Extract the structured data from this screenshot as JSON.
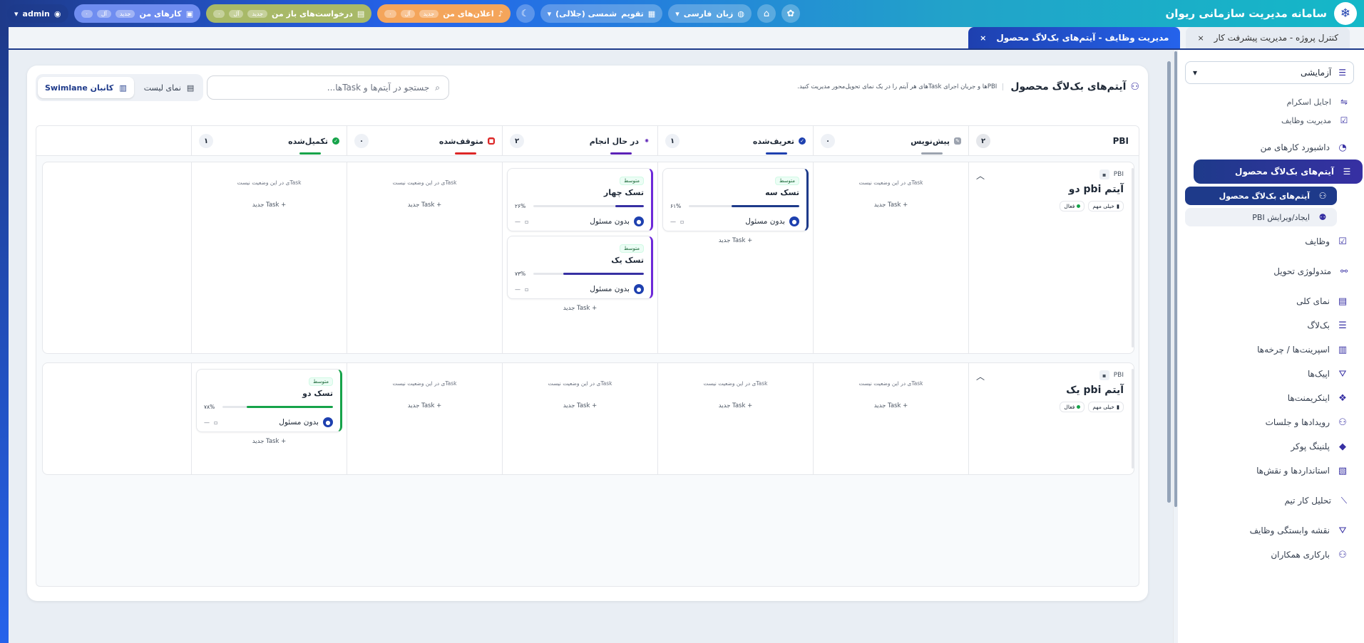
{
  "app": {
    "title": "سامانه مدیریت سازمانی ریوان",
    "logo_icon": "snowflake-icon"
  },
  "topbar": {
    "announcements": {
      "label": "اعلان‌های من",
      "chip_new": "جدید",
      "chip_all": "آل",
      "chip_count": "۰"
    },
    "requests": {
      "label": "درخواست‌های باز من",
      "chip_new": "جدید",
      "chip_all": "آل",
      "chip_count": "۰"
    },
    "my_tasks": {
      "label": "کارهای من",
      "chip_new": "جدید",
      "chip_all": "آل",
      "chip_count": "۰"
    },
    "calendar": {
      "label": "تقویم",
      "value": "شمسی (جلالی)"
    },
    "language": {
      "label": "زبان",
      "value": "فارسی"
    },
    "user": {
      "name": "admin"
    }
  },
  "tabs": [
    {
      "label": "کنترل پروژه  -  مدیریت پیشرفت کار",
      "active": false
    },
    {
      "label": "مدیریت وظایف  -  آیتم‌های بک‌لاگ محصول",
      "active": true
    }
  ],
  "sidebar": {
    "workspace": "آزمایشی",
    "crumb_scrum": "اجایل اسکرام",
    "crumb_tasks": "مدیریت وظایف",
    "items": [
      {
        "label": "داشبورد کارهای من"
      },
      {
        "label": "آیتم‌های بک‌لاگ محصول"
      },
      {
        "label": "آیتم‌های بک‌لاگ محصول"
      },
      {
        "label": "ایجاد/ویرایش PBI"
      },
      {
        "label": "وظایف"
      }
    ],
    "section_delivery": "متدولوژی تحویل",
    "delivery_items": [
      {
        "label": "نمای کلی"
      },
      {
        "label": "بک‌لاگ"
      },
      {
        "label": "اسپرینت‌ها / چرخه‌ها"
      },
      {
        "label": "اپیک‌ها"
      },
      {
        "label": "اینکریمنت‌ها"
      },
      {
        "label": "رویدادها و جلسات"
      },
      {
        "label": "پلنینگ پوکر"
      },
      {
        "label": "استانداردها و نقش‌ها"
      }
    ],
    "section_analysis": "تحلیل کار تیم",
    "analysis_items": [
      {
        "label": "نقشه وابستگی وظایف"
      },
      {
        "label": "بارکاری همکاران"
      }
    ]
  },
  "page": {
    "title": "آیتم‌های بک‌لاگ محصول",
    "description": "PBIها و جریان اجرای Taskهای هر آیتم را در یک نمای تحویل‌محور مدیریت کنید.",
    "search_placeholder": "جستجو در آیتم‌ها و Taskها...",
    "view_list": "نمای لیست",
    "view_kanban": "کانبان Swimlane"
  },
  "columns": {
    "pbi": {
      "label": "PBI",
      "count": "۲"
    },
    "statuses": [
      {
        "label": "پیش‌نویس",
        "count": "۰",
        "color": "#9ca3af"
      },
      {
        "label": "تعریف‌شده",
        "count": "۱",
        "color": "#1e40af"
      },
      {
        "label": "در حال انجام",
        "count": "۲",
        "color": "#5b21b6"
      },
      {
        "label": "متوقف‌شده",
        "count": "۰",
        "color": "#dc2626"
      },
      {
        "label": "تکمیل‌شده",
        "count": "۱",
        "color": "#16a34a"
      }
    ]
  },
  "common": {
    "empty": "Taskی در این وضعیت نیست",
    "add_task": "+ Task جدید",
    "no_assignee": "بدون مسئول",
    "date": "—"
  },
  "lanes": [
    {
      "tag": "PBI",
      "title": "آیتم pbi دو",
      "priority": "خیلی مهم",
      "state": "فعال",
      "cards": {
        "defined": [
          {
            "priority": "متوسط",
            "title": "تسک سه",
            "progress": 61,
            "progress_label": "۶۱%"
          }
        ],
        "in_progress": [
          {
            "priority": "متوسط",
            "title": "تسک چهار",
            "progress": 26,
            "progress_label": "۲۶%"
          },
          {
            "priority": "متوسط",
            "title": "تسک یک",
            "progress": 73,
            "progress_label": "۷۳%"
          }
        ]
      }
    },
    {
      "tag": "PBI",
      "title": "آیتم pbi یک",
      "priority": "خیلی مهم",
      "state": "فعال",
      "cards": {
        "done": [
          {
            "priority": "متوسط",
            "title": "تسک دو",
            "progress": 78,
            "progress_label": "۷۸%"
          }
        ]
      }
    }
  ]
}
